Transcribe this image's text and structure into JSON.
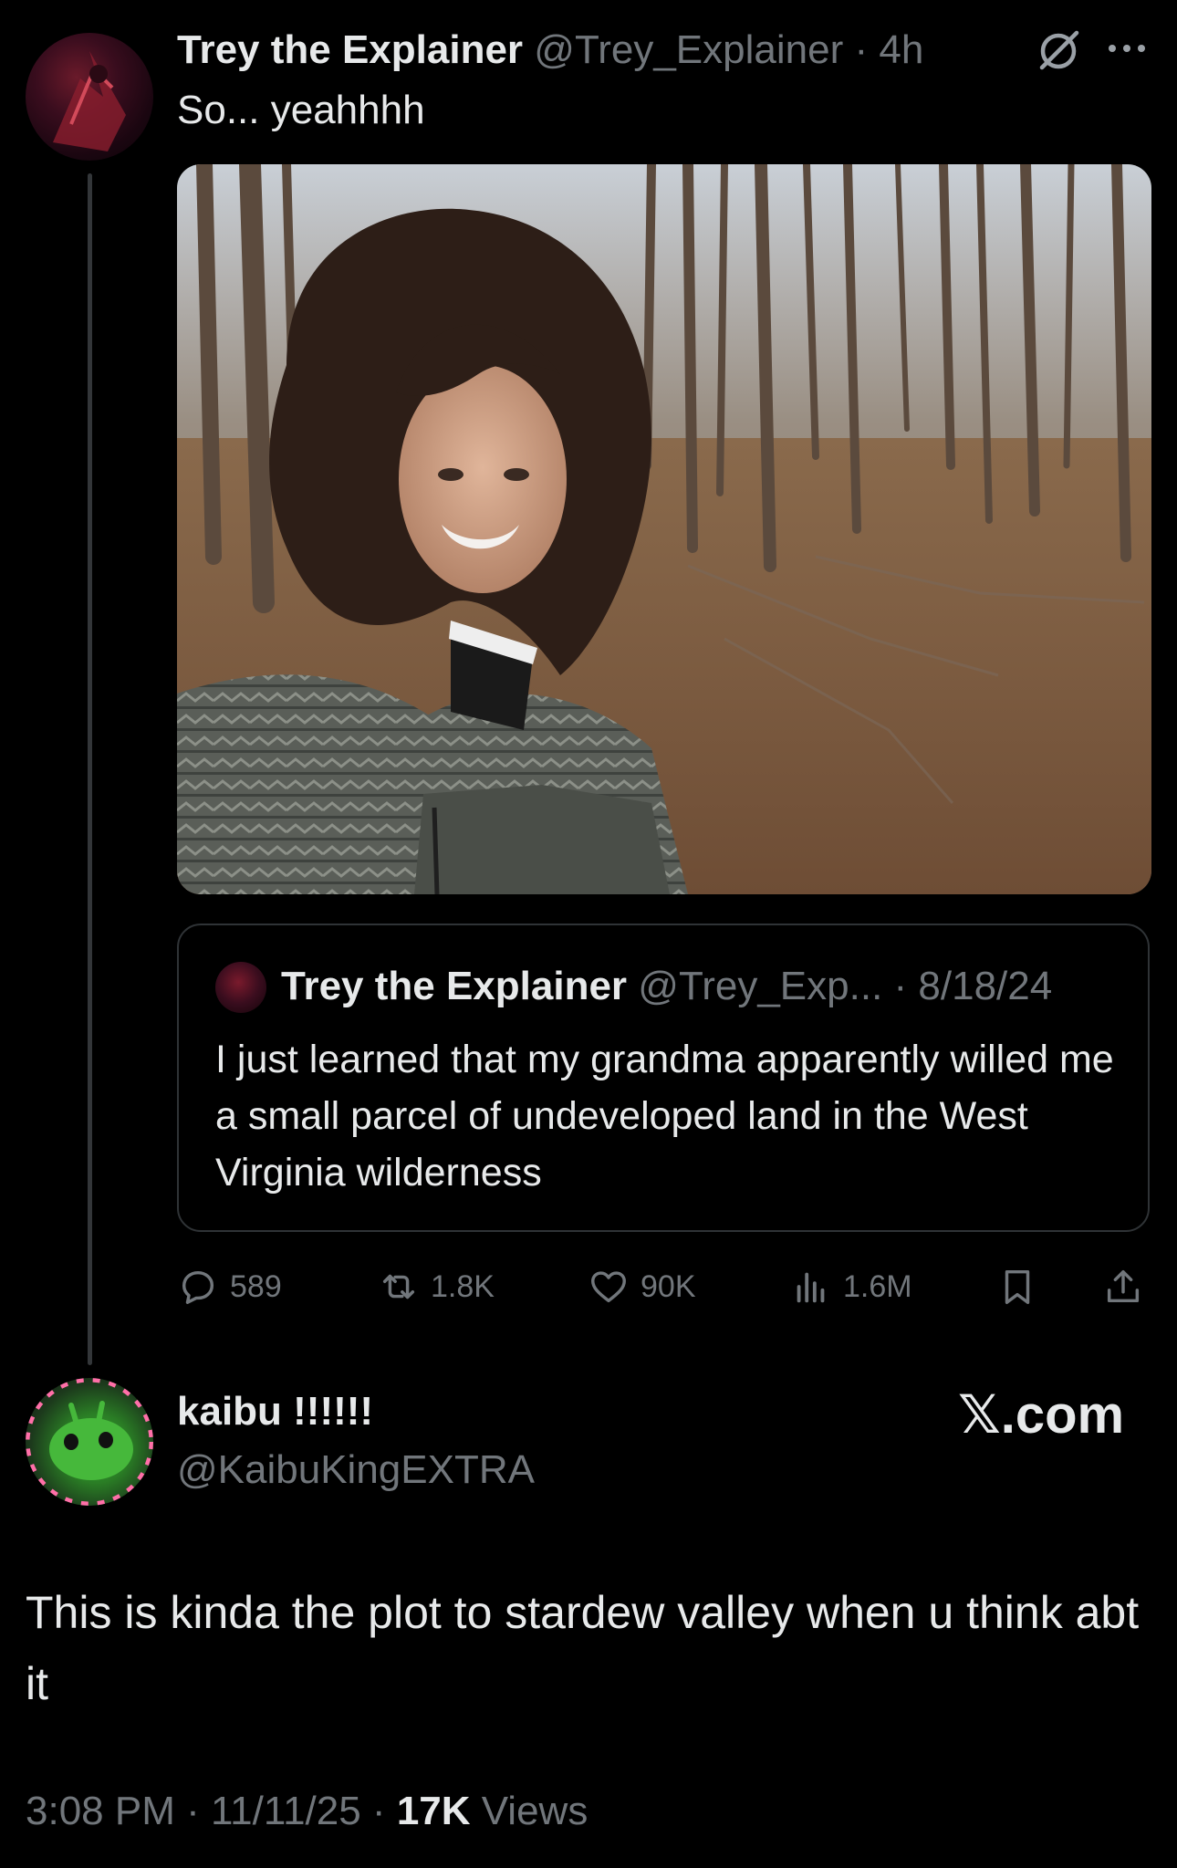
{
  "colors": {
    "background": "#000000",
    "text": "#e7e9ea",
    "muted": "#71767b",
    "border": "#2f3336"
  },
  "post": {
    "author_name": "Trey the Explainer",
    "handle": "@Trey_Explainer",
    "time": "· 4h",
    "text": "So... yeahhhh",
    "icons": [
      "grok-icon",
      "more-icon"
    ]
  },
  "quote": {
    "author_name": "Trey the Explainer",
    "handle": "@Trey_Exp...",
    "date": "· 8/18/24",
    "text": "I just learned that my grandma apparently willed me a small parcel of undeveloped land in the West Virginia wilderness"
  },
  "actions": {
    "replies": "589",
    "reposts": "1.8K",
    "likes": "90K",
    "views": "1.6M"
  },
  "reply": {
    "author_name": "kaibu !!!!!!",
    "handle": "@KaibuKingEXTRA",
    "text": "This is kinda the plot to stardew valley when u think abt it",
    "watermark_prefix": "𝕏",
    "watermark_suffix": ".com",
    "timestamp": "3:08 PM · 11/11/25 · ",
    "views_count": "17K",
    "views_label": " Views"
  }
}
